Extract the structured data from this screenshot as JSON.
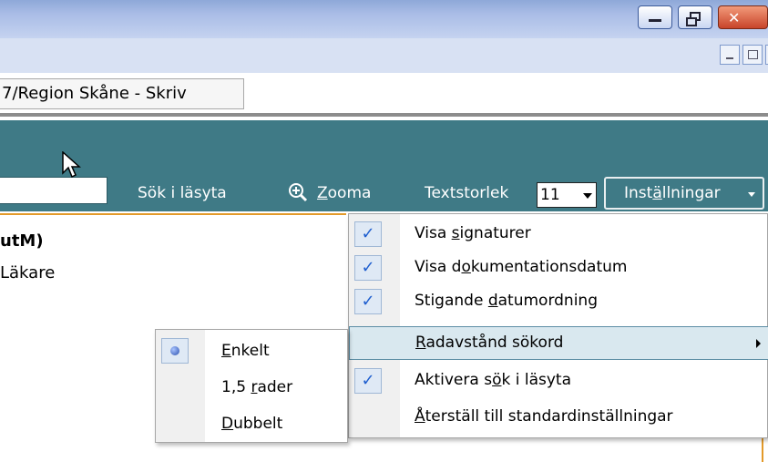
{
  "window": {
    "tab_title": "7/Region Skåne - Skriv",
    "close_glyph": "✕"
  },
  "toolbar": {
    "search_label": "Sök i läsyta",
    "zoom_label": "Zooma",
    "textsize_label": "Textstorlek",
    "textsize_value": "11",
    "settings_label": "Inställningar"
  },
  "content": {
    "title": "utM)",
    "subtitle": "Läkare"
  },
  "settings_menu": {
    "items": [
      {
        "pre": "Visa ",
        "u": "s",
        "post": "ignaturer",
        "checked": true
      },
      {
        "pre": "Visa d",
        "u": "o",
        "post": "kumentationsdatum",
        "checked": true
      },
      {
        "pre": "Stigande ",
        "u": "d",
        "post": "atumordning",
        "checked": true
      },
      {
        "pre": "",
        "u": "R",
        "post": "adavstånd sökord",
        "checked": false
      },
      {
        "pre": "Aktivera s",
        "u": "ö",
        "post": "k i läsyta",
        "checked": true
      },
      {
        "pre": "",
        "u": "Å",
        "post": "terställ till standardinställningar",
        "checked": false
      }
    ]
  },
  "spacing_submenu": {
    "items": [
      {
        "pre": "",
        "u": "E",
        "post": "nkelt",
        "selected": true
      },
      {
        "pre": "1,5 ",
        "u": "r",
        "post": "ader",
        "selected": false
      },
      {
        "pre": "",
        "u": "D",
        "post": "ubbelt",
        "selected": false
      }
    ]
  },
  "colors": {
    "header_teal": "#3f7a86",
    "accent_orange": "#e39a2a",
    "check_blue": "#1f5fcf"
  }
}
